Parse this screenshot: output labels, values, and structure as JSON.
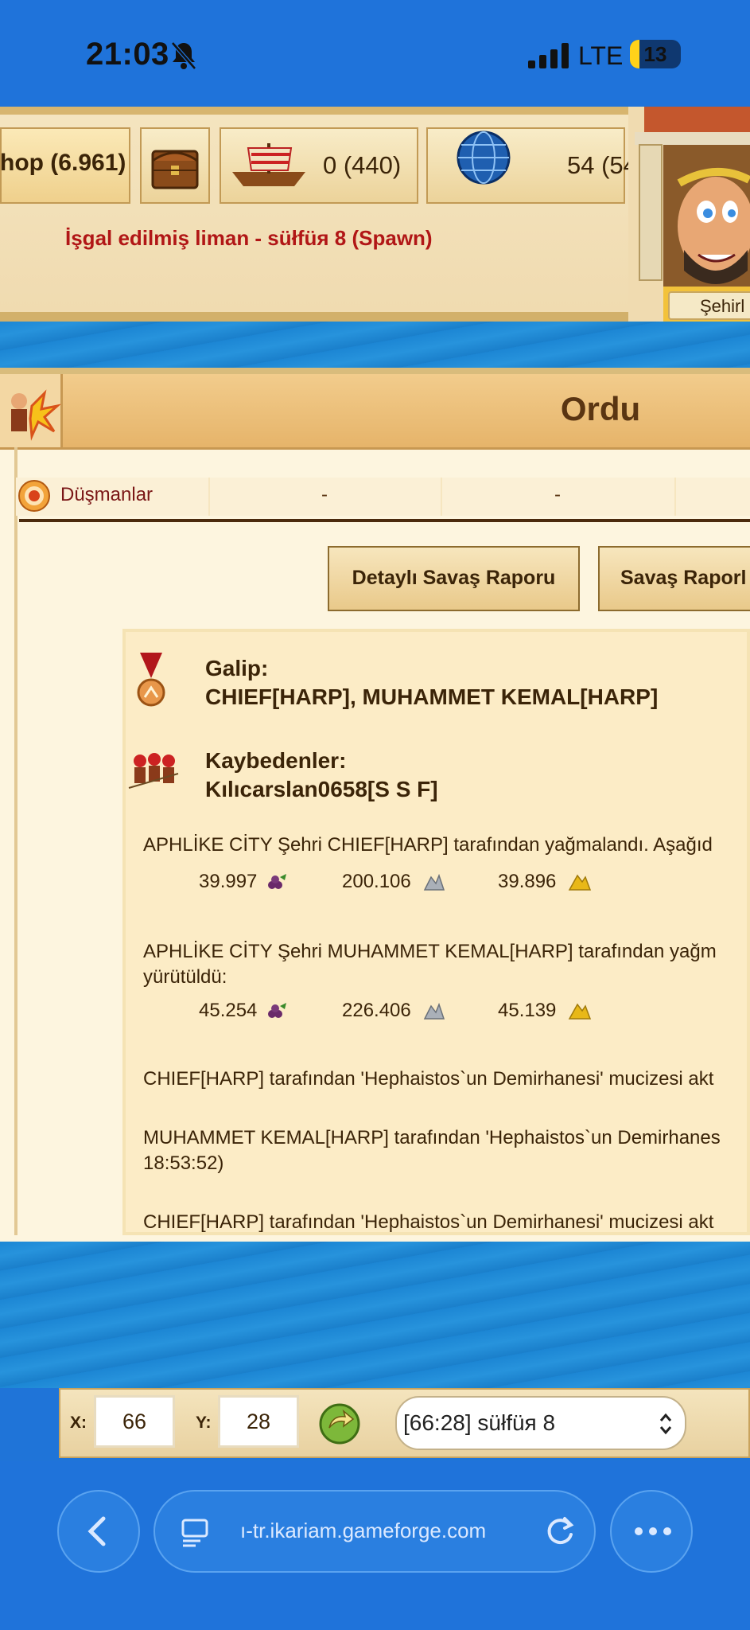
{
  "status_bar": {
    "time": "21:03",
    "network": "LTE",
    "battery": "13"
  },
  "top_bar": {
    "shop_label": "hop (6.961)",
    "ships": "0 (440)",
    "globe_value": "54 (54",
    "occupied_port": "İşgal edilmiş liman - süłfüя 8 (Spawn)",
    "advisor_label": "Şehirl"
  },
  "panel": {
    "title": "Ordu",
    "enemies_label": "Düşmanlar",
    "enemies_values": [
      "-",
      "-"
    ],
    "buttons": {
      "detailed_report": "Detaylı Savaş Raporu",
      "report": "Savaş Raporl"
    }
  },
  "report": {
    "winner_heading": "Galip:",
    "winners": "CHIEF[HARP], MUHAMMET KEMAL[HARP]",
    "losers_heading": "Kaybedenler:",
    "losers": "Kılıcarslan0658[S S F]",
    "plunder_1_text": "APHLİKE CİTY Şehri CHIEF[HARP] tarafından yağmalandı. Aşağıd",
    "plunder_1_values": [
      "39.997",
      "200.106",
      "39.896"
    ],
    "plunder_2_text": "APHLİKE CİTY Şehri MUHAMMET KEMAL[HARP] tarafından yağm",
    "plunder_2_text_line2": "yürütüldü:",
    "plunder_2_values": [
      "45.254",
      "226.406",
      "45.139"
    ],
    "miracle_1": "CHIEF[HARP] tarafından 'Hephaistos`un Demirhanesi' mucizesi akt",
    "miracle_2": "MUHAMMET KEMAL[HARP] tarafından 'Hephaistos`un Demirhanes",
    "miracle_2_line2": "18:53:52)",
    "miracle_3": "CHIEF[HARP] tarafından 'Hephaistos`un Demirhanesi' mucizesi akt"
  },
  "coords": {
    "x_label": "X:",
    "x_value": "66",
    "y_label": "Y:",
    "y_value": "28",
    "island_select": "[66:28] süłfüя 8"
  },
  "browser": {
    "url": "ı-tr.ikariam.gameforge.com"
  },
  "colors": {
    "status_blue": "#1f73da",
    "parchment": "#fcecc6",
    "title_brown": "#5a3512",
    "alert_red": "#b11616"
  }
}
